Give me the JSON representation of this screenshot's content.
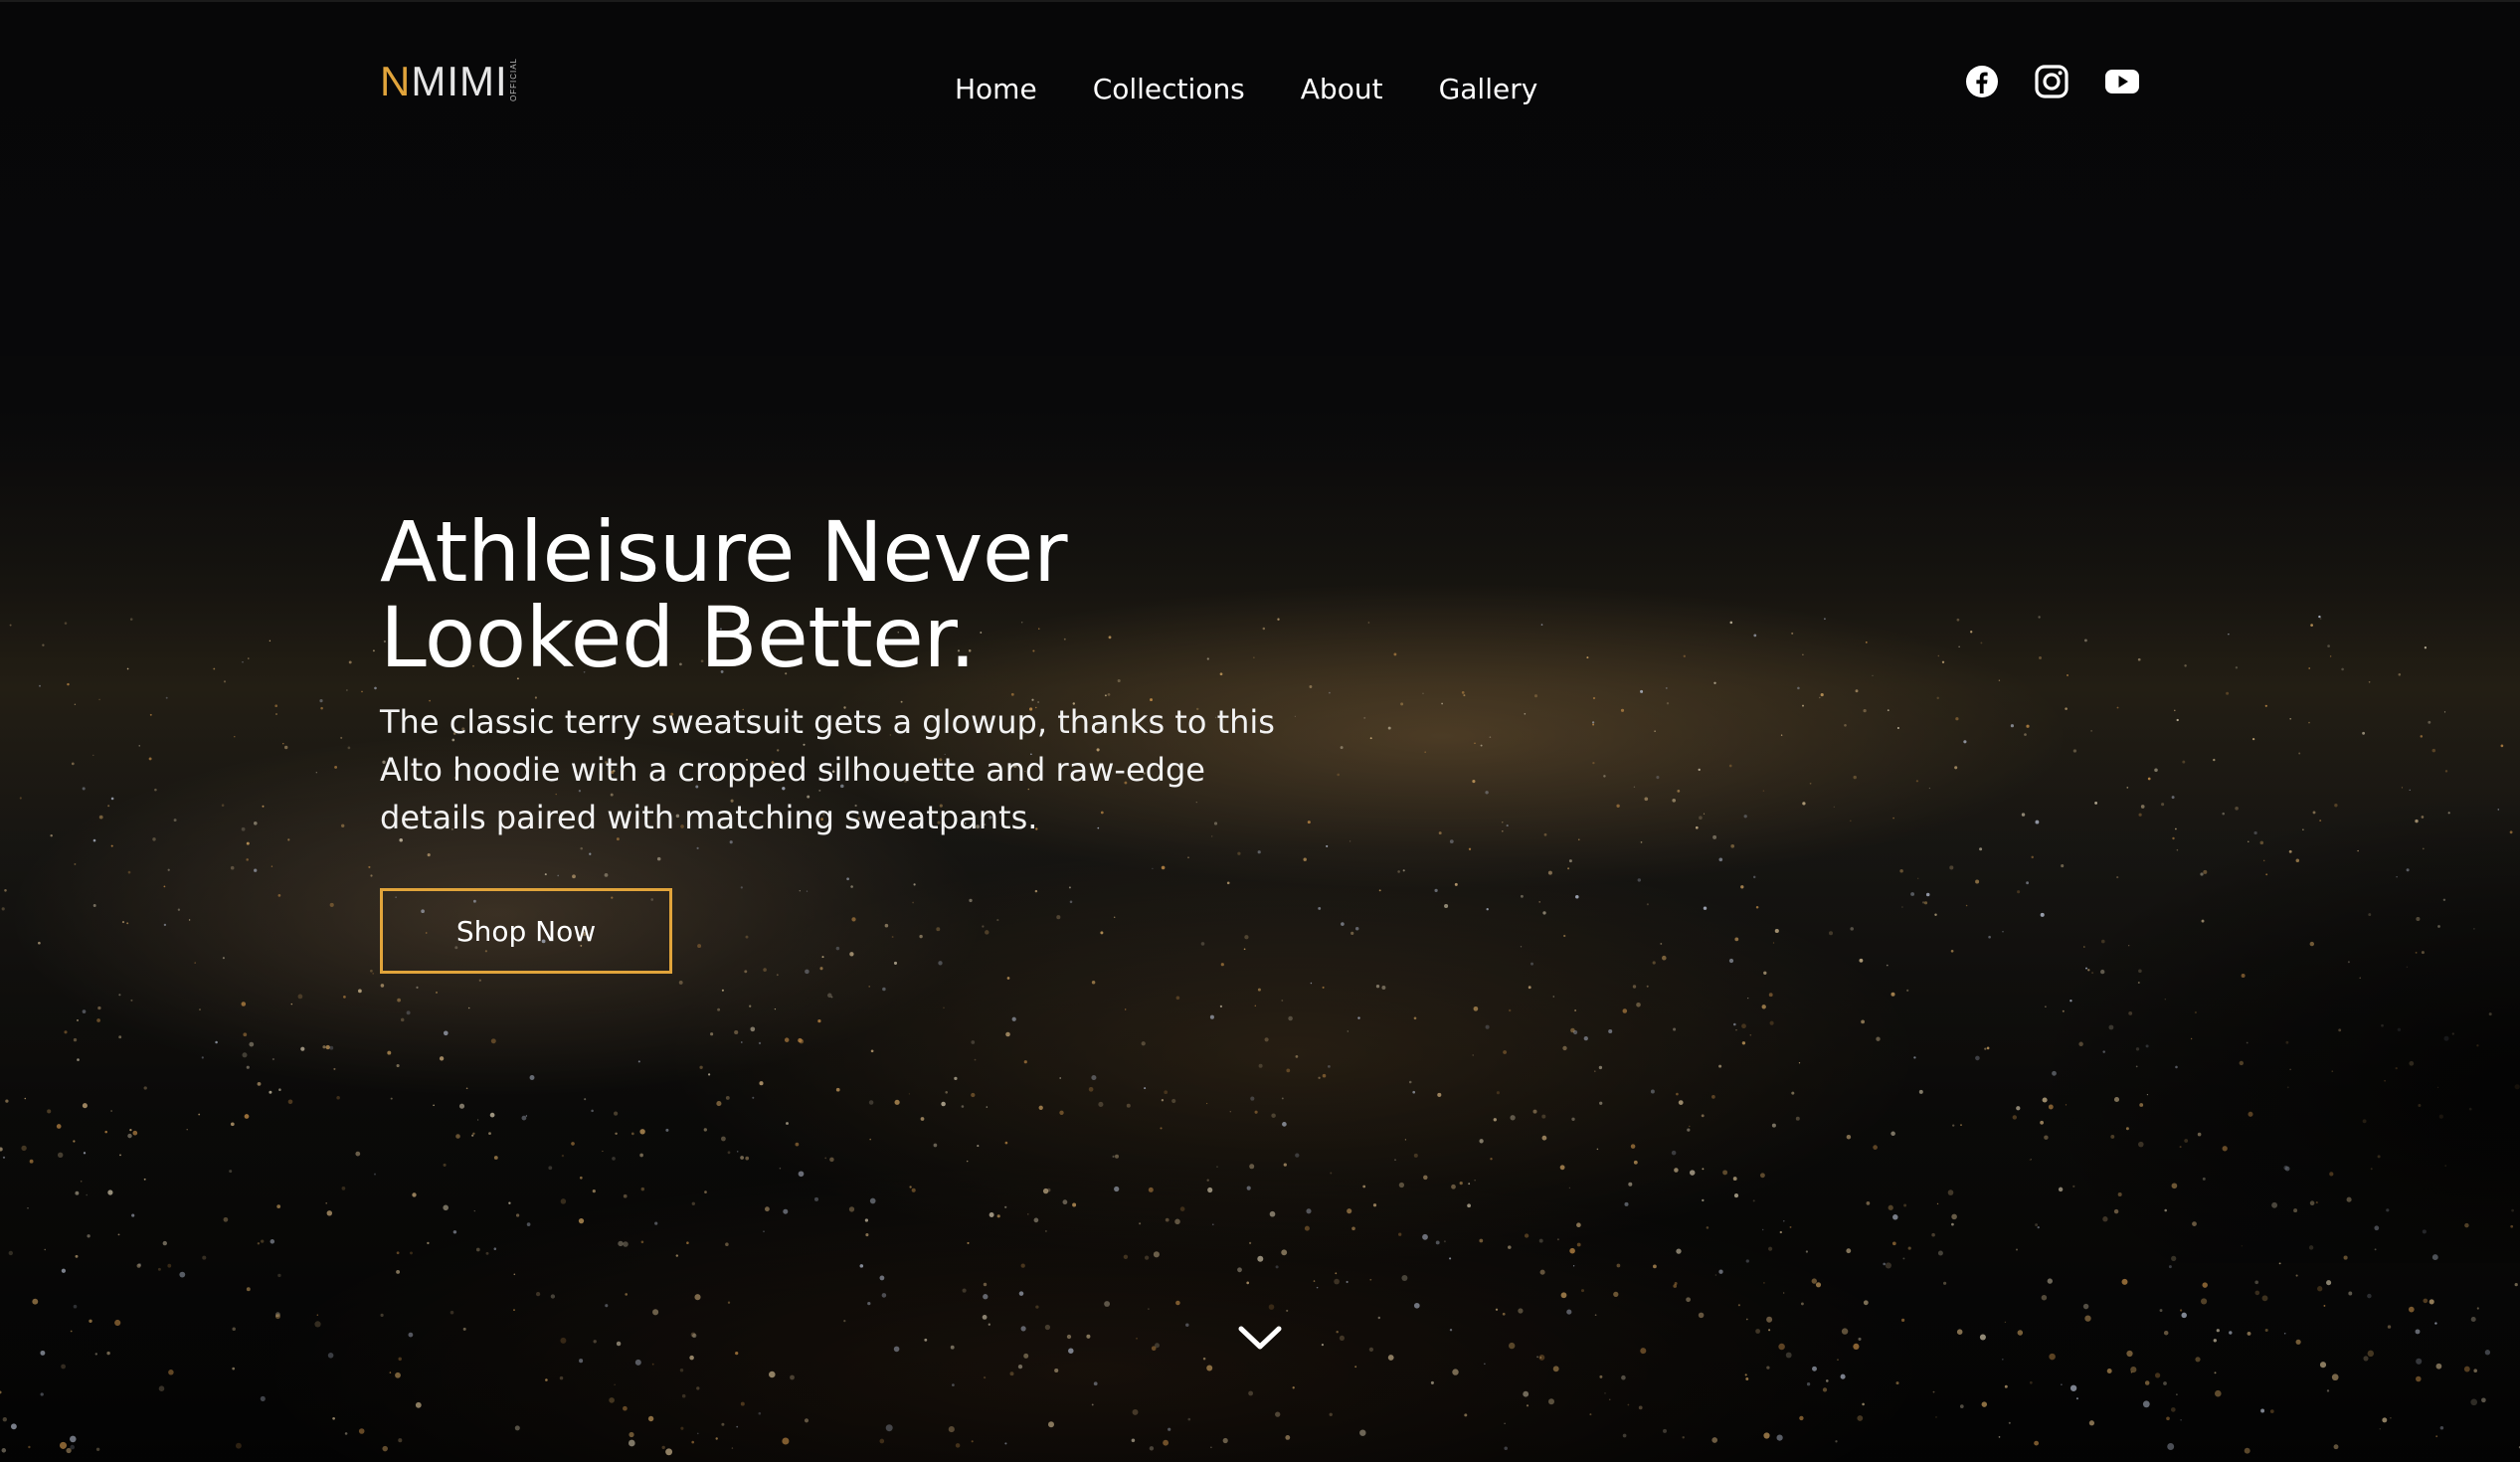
{
  "brand": {
    "logo_first": "N",
    "logo_rest": "MIMI",
    "logo_small": "OFFICIAL",
    "accent_color": "#e1a43b"
  },
  "nav": {
    "items": [
      {
        "label": "Home"
      },
      {
        "label": "Collections"
      },
      {
        "label": "About"
      },
      {
        "label": "Gallery"
      }
    ]
  },
  "social": {
    "icons": [
      "facebook-icon",
      "instagram-icon",
      "youtube-icon"
    ]
  },
  "hero": {
    "headline_line1": "Athleisure Never",
    "headline_line2": "Looked Better.",
    "description": "The classic terry sweatsuit gets a glowup, thanks to this Alto hoodie with a cropped silhouette and raw-edge details paired with matching sweatpants.",
    "cta_label": "Shop Now",
    "background": "night-city-lights-image"
  },
  "scroll": {
    "icon": "chevron-down-icon"
  }
}
